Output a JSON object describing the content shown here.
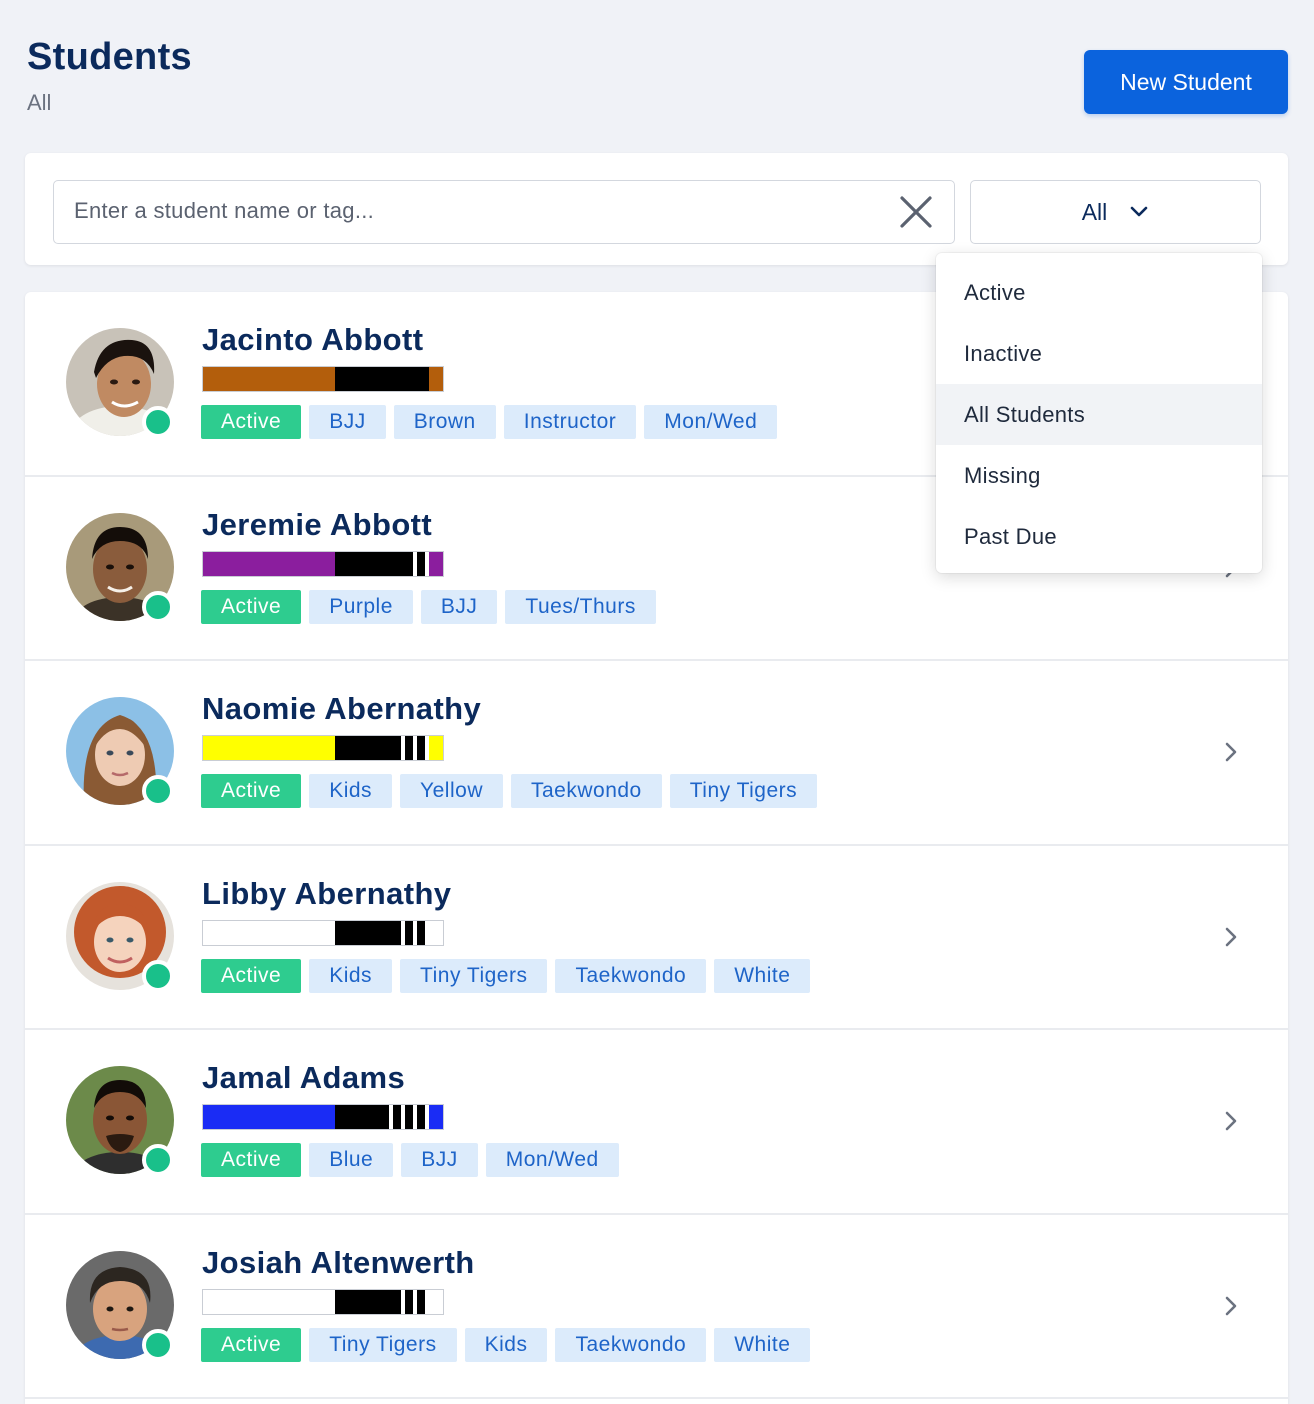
{
  "header": {
    "title": "Students",
    "subtitle": "All",
    "new_button": "New Student"
  },
  "search": {
    "placeholder": "Enter a student name or tag...",
    "value": "",
    "clear_icon": "close-icon"
  },
  "filter": {
    "selected": "All",
    "options": [
      "Active",
      "Inactive",
      "All Students",
      "Missing",
      "Past Due"
    ],
    "highlighted": "All Students"
  },
  "students": [
    {
      "name": "Jacinto Abbott",
      "status": "Active",
      "tags": [
        "BJJ",
        "Brown",
        "Instructor",
        "Mon/Wed"
      ],
      "belt_color": "#b35e0c",
      "stripes": 0,
      "has_end_color": true
    },
    {
      "name": "Jeremie Abbott",
      "status": "Active",
      "tags": [
        "Purple",
        "BJJ",
        "Tues/Thurs"
      ],
      "belt_color": "#8b1e9e",
      "stripes": 1,
      "has_end_color": true
    },
    {
      "name": "Naomie Abernathy",
      "status": "Active",
      "tags": [
        "Kids",
        "Yellow",
        "Taekwondo",
        "Tiny Tigers"
      ],
      "belt_color": "#ffff00",
      "stripes": 2,
      "has_end_color": true
    },
    {
      "name": "Libby Abernathy",
      "status": "Active",
      "tags": [
        "Kids",
        "Tiny Tigers",
        "Taekwondo",
        "White"
      ],
      "belt_color": "#ffffff",
      "stripes": 2,
      "has_end_color": true
    },
    {
      "name": "Jamal Adams",
      "status": "Active",
      "tags": [
        "Blue",
        "BJJ",
        "Mon/Wed"
      ],
      "belt_color": "#1a2cf5",
      "stripes": 3,
      "has_end_color": true
    },
    {
      "name": "Josiah Altenwerth",
      "status": "Active",
      "tags": [
        "Tiny Tigers",
        "Kids",
        "Taekwondo",
        "White"
      ],
      "belt_color": "#ffffff",
      "stripes": 2,
      "has_end_color": true
    }
  ],
  "colors": {
    "primary": "#0b63dd",
    "active_status": "#2ecc8f",
    "tag_bg": "#dcebfb",
    "tag_text": "#1e64c8"
  }
}
